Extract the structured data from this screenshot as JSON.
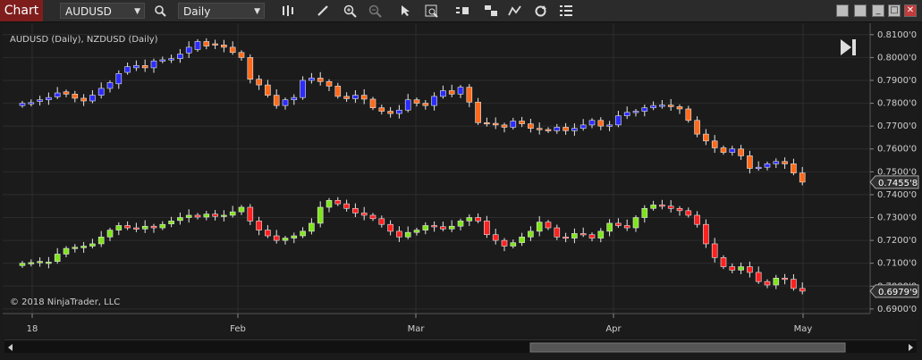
{
  "toolbar": {
    "tab": "Chart",
    "instrument": "AUDUSD",
    "period": "Daily",
    "icons": [
      "search-icon",
      "bar-type-icon",
      "draw-pencil-icon",
      "zoom-in-icon",
      "zoom-out-icon",
      "pointer-icon",
      "data-box-icon",
      "instrument-toggle-icon",
      "properties-icon",
      "indicators-icon",
      "refresh-icon",
      "list-icon"
    ]
  },
  "window": {
    "buttons": [
      "restore-button",
      "maximize-button",
      "minimize-button",
      "window-restore-button",
      "close-button"
    ]
  },
  "chart": {
    "instruments_label": "AUDUSD (Daily), NZDUSD (Daily)",
    "copyright": "© 2018 NinjaTrader, LLC",
    "last_price_1": "0.7455'8",
    "last_price_2": "0.6979'9",
    "x_labels": [
      "18",
      "Feb",
      "Mar",
      "Apr",
      "May"
    ],
    "y_labels": [
      "0.8100'0",
      "0.8000'0",
      "0.7900'0",
      "0.7800'0",
      "0.7700'0",
      "0.7600'0",
      "0.7500'0",
      "0.7400'0",
      "0.7300'0",
      "0.7200'0",
      "0.7100'0",
      "0.7000'0",
      "0.6900'0"
    ]
  },
  "chart_data": {
    "type": "candlestick",
    "ylim": [
      0.688,
      0.815
    ],
    "x_ticks": [
      "18",
      "Feb",
      "Mar",
      "Apr",
      "May"
    ],
    "series": [
      {
        "name": "AUDUSD",
        "up_color": "#2b2bff",
        "down_color": "#ff6a1a",
        "close": [
          0.78,
          0.7803,
          0.7815,
          0.7825,
          0.7845,
          0.784,
          0.7822,
          0.781,
          0.7835,
          0.7865,
          0.789,
          0.793,
          0.796,
          0.7965,
          0.7955,
          0.7985,
          0.799,
          0.7995,
          0.8015,
          0.8045,
          0.807,
          0.805,
          0.8055,
          0.8045,
          0.8022,
          0.8,
          0.7905,
          0.788,
          0.7835,
          0.779,
          0.7815,
          0.7825,
          0.79,
          0.791,
          0.7895,
          0.7875,
          0.783,
          0.782,
          0.7835,
          0.7818,
          0.778,
          0.7765,
          0.7755,
          0.777,
          0.7815,
          0.78,
          0.779,
          0.783,
          0.7855,
          0.784,
          0.787,
          0.7805,
          0.7715,
          0.7712,
          0.7705,
          0.7695,
          0.7722,
          0.771,
          0.769,
          0.7685,
          0.768,
          0.7695,
          0.768,
          0.769,
          0.7705,
          0.7725,
          0.77,
          0.7705,
          0.7745,
          0.776,
          0.7765,
          0.778,
          0.779,
          0.7792,
          0.7785,
          0.7775,
          0.7725,
          0.7665,
          0.7635,
          0.7605,
          0.7585,
          0.76,
          0.757,
          0.7515,
          0.752,
          0.7535,
          0.7545,
          0.7535,
          0.7495,
          0.7455
        ],
        "open": [
          0.779,
          0.78,
          0.7808,
          0.7815,
          0.7828,
          0.785,
          0.784,
          0.7822,
          0.781,
          0.7835,
          0.7865,
          0.7885,
          0.7935,
          0.7955,
          0.7965,
          0.7955,
          0.7985,
          0.799,
          0.7995,
          0.802,
          0.8035,
          0.807,
          0.806,
          0.8055,
          0.8045,
          0.8022,
          0.8,
          0.7905,
          0.788,
          0.7835,
          0.779,
          0.7815,
          0.7825,
          0.79,
          0.791,
          0.7895,
          0.7875,
          0.783,
          0.782,
          0.7835,
          0.7818,
          0.778,
          0.7765,
          0.7755,
          0.777,
          0.7815,
          0.78,
          0.779,
          0.783,
          0.7855,
          0.784,
          0.787,
          0.7805,
          0.7715,
          0.7712,
          0.7705,
          0.7695,
          0.7722,
          0.771,
          0.769,
          0.7685,
          0.768,
          0.7695,
          0.768,
          0.769,
          0.7705,
          0.7725,
          0.77,
          0.7705,
          0.7745,
          0.776,
          0.7765,
          0.778,
          0.779,
          0.7792,
          0.7785,
          0.7775,
          0.7725,
          0.7665,
          0.7635,
          0.7605,
          0.7585,
          0.76,
          0.757,
          0.7515,
          0.752,
          0.7535,
          0.7545,
          0.7535,
          0.7495
        ]
      },
      {
        "name": "NZDUSD",
        "up_color": "#7fe51a",
        "down_color": "#ff2020",
        "close": [
          0.71,
          0.7103,
          0.7108,
          0.7105,
          0.714,
          0.7165,
          0.717,
          0.7175,
          0.7185,
          0.7215,
          0.7245,
          0.7265,
          0.7255,
          0.725,
          0.7262,
          0.7255,
          0.727,
          0.7285,
          0.73,
          0.731,
          0.7302,
          0.7315,
          0.7305,
          0.731,
          0.7325,
          0.7345,
          0.7285,
          0.7245,
          0.722,
          0.72,
          0.721,
          0.722,
          0.724,
          0.7275,
          0.7345,
          0.7375,
          0.736,
          0.734,
          0.732,
          0.731,
          0.7295,
          0.727,
          0.724,
          0.7215,
          0.7235,
          0.7245,
          0.7265,
          0.726,
          0.725,
          0.7262,
          0.7285,
          0.73,
          0.7285,
          0.7225,
          0.72,
          0.7175,
          0.719,
          0.7215,
          0.724,
          0.728,
          0.7255,
          0.7215,
          0.721,
          0.723,
          0.7225,
          0.721,
          0.724,
          0.7275,
          0.7265,
          0.7255,
          0.73,
          0.734,
          0.7355,
          0.735,
          0.734,
          0.733,
          0.731,
          0.727,
          0.7185,
          0.7125,
          0.7085,
          0.707,
          0.7085,
          0.706,
          0.702,
          0.7005,
          0.7035,
          0.703,
          0.699,
          0.6978
        ],
        "open": [
          0.709,
          0.71,
          0.7103,
          0.71,
          0.7108,
          0.714,
          0.7165,
          0.7168,
          0.7175,
          0.7185,
          0.7215,
          0.7245,
          0.7265,
          0.7255,
          0.725,
          0.7262,
          0.7255,
          0.7272,
          0.7287,
          0.73,
          0.731,
          0.7302,
          0.7315,
          0.7305,
          0.731,
          0.7325,
          0.7345,
          0.7285,
          0.7245,
          0.722,
          0.72,
          0.721,
          0.722,
          0.724,
          0.7275,
          0.7345,
          0.7375,
          0.736,
          0.734,
          0.732,
          0.731,
          0.7295,
          0.727,
          0.724,
          0.7215,
          0.7235,
          0.7245,
          0.7265,
          0.726,
          0.725,
          0.7262,
          0.7285,
          0.73,
          0.7285,
          0.7225,
          0.72,
          0.7175,
          0.719,
          0.7215,
          0.724,
          0.728,
          0.7255,
          0.7215,
          0.721,
          0.723,
          0.7225,
          0.721,
          0.724,
          0.7275,
          0.7265,
          0.7255,
          0.73,
          0.734,
          0.7355,
          0.735,
          0.734,
          0.733,
          0.731,
          0.727,
          0.7185,
          0.7125,
          0.7085,
          0.707,
          0.7085,
          0.706,
          0.702,
          0.7005,
          0.7035,
          0.703,
          0.699
        ]
      }
    ]
  }
}
